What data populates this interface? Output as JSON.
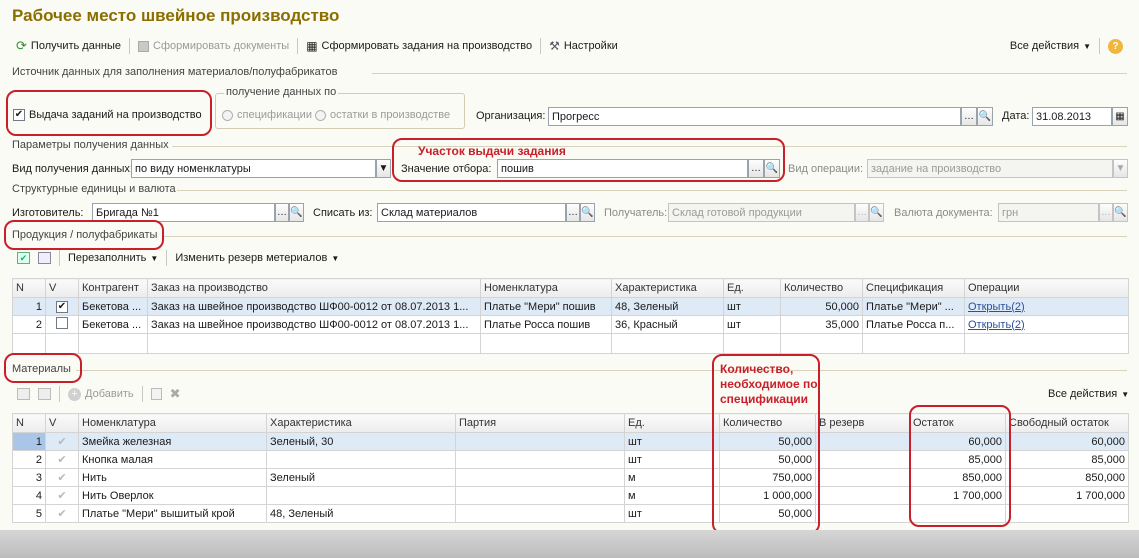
{
  "window": {
    "title": "Рабочее место швейное производство"
  },
  "toolbar": {
    "get_data": "Получить данные",
    "form_docs": "Сформировать документы",
    "form_tasks": "Сформировать задания на производство",
    "settings": "Настройки",
    "all_actions": "Все действия",
    "help": "?"
  },
  "source": {
    "section_title": "Источник данных для заполнения материалов/полуфабрикатов",
    "issue_tasks_label": "Выдача заданий на производство",
    "group_title": "получение данных по",
    "radio_spec": "спецификации",
    "radio_remains": "остатки в производстве",
    "org_label": "Организация:",
    "org_value": "Прогресс",
    "date_label": "Дата:",
    "date_value": "31.08.2013"
  },
  "params": {
    "section_title": "Параметры получения данных",
    "kind_label": "Вид получения данных:",
    "kind_value": "по виду номенклатуры",
    "filter_label": "Значение отбора:",
    "filter_value": "пошив",
    "op_label": "Вид операции:",
    "op_value": "задание на производство"
  },
  "units": {
    "section_title": "Структурные единицы и валюта",
    "maker_label": "Изготовитель:",
    "maker_value": "Бригада №1",
    "writeoff_label": "Списать из:",
    "writeoff_value": "Склад материалов",
    "receiver_label": "Получатель:",
    "receiver_value": "Склад готовой продукции",
    "currency_label": "Валюта документа:",
    "currency_value": "грн"
  },
  "annotations": {
    "issue_area": "Участок выдачи задания",
    "qty_note_1": "Количество,",
    "qty_note_2": "необходимое по",
    "qty_note_3": "спецификации"
  },
  "products": {
    "section_title": "Продукция / полуфабрикаты",
    "refill": "Перезаполнить",
    "change_reserve": "Изменить резерв метериалов",
    "columns": [
      "N",
      "V",
      "Контрагент",
      "Заказ на производство",
      "Номенклатура",
      "Характеристика",
      "Ед.",
      "Количество",
      "Спецификация",
      "Операции"
    ],
    "rows": [
      {
        "n": "1",
        "checked": true,
        "contractor": "Бекетова ...",
        "order": "Заказ на швейное производство ШФ00-0012 от 08.07.2013 1...",
        "item": "Платье \"Мери\" пошив",
        "char": "48, Зеленый",
        "unit": "шт",
        "qty": "50,000",
        "spec": "Платье \"Мери\" ...",
        "ops": "Открыть(2)"
      },
      {
        "n": "2",
        "checked": false,
        "contractor": "Бекетова ...",
        "order": "Заказ на швейное производство ШФ00-0012 от 08.07.2013 1...",
        "item": "Платье Росса пошив",
        "char": "36, Красный",
        "unit": "шт",
        "qty": "35,000",
        "spec": "Платье Росса п...",
        "ops": "Открыть(2)"
      }
    ]
  },
  "materials": {
    "section_title": "Материалы",
    "add": "Добавить",
    "all_actions": "Все действия",
    "columns": [
      "N",
      "V",
      "Номенклатура",
      "Характеристика",
      "Партия",
      "Ед.",
      "Количество",
      "В резерв",
      "Остаток",
      "Свободный остаток"
    ],
    "rows": [
      {
        "n": "1",
        "item": "Змейка железная",
        "char": "Зеленый, 30",
        "batch": "",
        "unit": "шт",
        "qty": "50,000",
        "reserve": "",
        "rest": "60,000",
        "free": "60,000"
      },
      {
        "n": "2",
        "item": "Кнопка малая",
        "char": "",
        "batch": "",
        "unit": "шт",
        "qty": "50,000",
        "reserve": "",
        "rest": "85,000",
        "free": "85,000"
      },
      {
        "n": "3",
        "item": "Нить",
        "char": "Зеленый",
        "batch": "",
        "unit": "м",
        "qty": "750,000",
        "reserve": "",
        "rest": "850,000",
        "free": "850,000"
      },
      {
        "n": "4",
        "item": "Нить Оверлок",
        "char": "",
        "batch": "",
        "unit": "м",
        "qty": "1 000,000",
        "reserve": "",
        "rest": "1 700,000",
        "free": "1 700,000"
      },
      {
        "n": "5",
        "item": "Платье \"Мери\" вышитый крой",
        "char": "48, Зеленый",
        "batch": "",
        "unit": "шт",
        "qty": "50,000",
        "reserve": "",
        "rest": "",
        "free": ""
      }
    ]
  },
  "colors": {
    "title": "#8b6e00",
    "annotation": "#c8202a",
    "selection": "#dfeaf7"
  }
}
